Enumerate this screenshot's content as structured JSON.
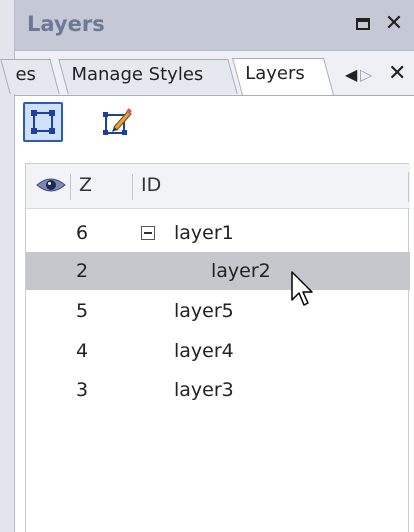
{
  "window": {
    "title": "Layers"
  },
  "tabs": [
    {
      "label": "es"
    },
    {
      "label": "Manage Styles"
    },
    {
      "label": "Layers",
      "active": true
    }
  ],
  "list": {
    "columns": {
      "visibility_icon": "eye-icon",
      "z": "Z",
      "id": "ID"
    },
    "rows": [
      {
        "z": "6",
        "id": "layer1",
        "expandable": true
      },
      {
        "z": "2",
        "id": "layer2",
        "selected": true
      },
      {
        "z": "5",
        "id": "layer5"
      },
      {
        "z": "4",
        "id": "layer4"
      },
      {
        "z": "3",
        "id": "layer3"
      }
    ]
  },
  "colors": {
    "selection_accent": "#2e5bb8",
    "selected_row": "#c6c7cc",
    "title_text": "#6f7894"
  }
}
